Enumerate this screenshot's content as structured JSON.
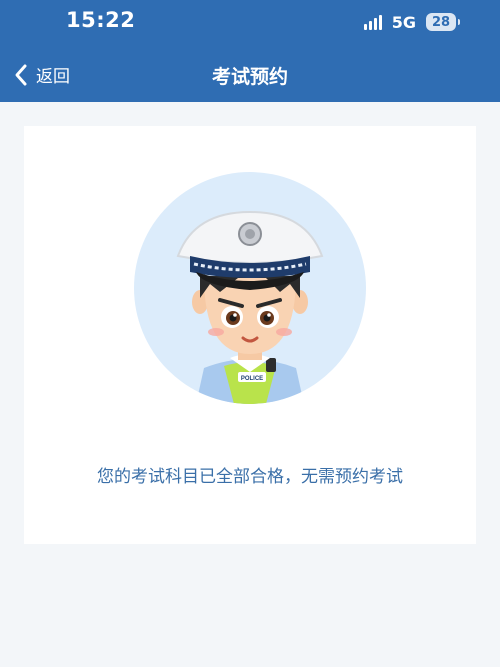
{
  "status_bar": {
    "time": "15:22",
    "network": "5G",
    "battery": "28"
  },
  "nav": {
    "back_label": "返回",
    "title": "考试预约"
  },
  "avatar": {
    "badge_text": "POLICE"
  },
  "message": "您的考试科目已全部合格，无需预约考试",
  "colors": {
    "header": "#2f6db3",
    "page_background": "#f3f6f9",
    "message_text": "#3a6fa8",
    "avatar_circle": "#dcecfb"
  }
}
